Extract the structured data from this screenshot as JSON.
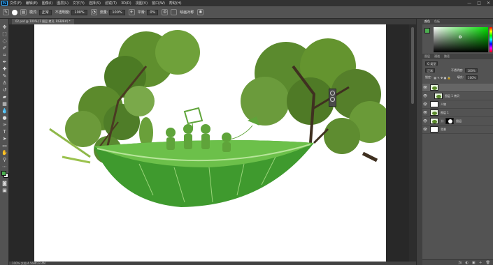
{
  "menubar": {
    "logo": "Ps",
    "items": [
      "文件(F)",
      "编辑(E)",
      "图像(I)",
      "图层(L)",
      "文字(Y)",
      "选择(S)",
      "滤镜(T)",
      "3D(D)",
      "视图(V)",
      "窗口(W)",
      "帮助(H)"
    ],
    "window_controls": [
      "—",
      "□",
      "✕"
    ]
  },
  "options": {
    "mode_label": "模式:",
    "mode_value": "正常",
    "opacity_label": "不透明度:",
    "opacity_value": "100%",
    "flow_label": "流量:",
    "flow_value": "100%",
    "smooth_label": "平滑:",
    "smooth_value": "0%",
    "symmetry_label": "绘画对称"
  },
  "document": {
    "tab_label": "02.psd @ 100% (1 图层 拷贝, RGB/8#) *",
    "status_text": "100%    文档:4.56M/33.4M"
  },
  "panels": {
    "color_tabs": [
      "颜色",
      "色板"
    ],
    "layer_tabs": [
      "图层",
      "通道",
      "路径"
    ],
    "kind_label": "Q 类型",
    "blend_mode": "正常",
    "opacity_label": "不透明度:",
    "opacity_value": "100%",
    "lock_label": "锁定:",
    "fill_label": "填充:",
    "fill_value": "100%",
    "layers": [
      {
        "name": "",
        "selected": true,
        "type": "tree"
      },
      {
        "name": "图层 1 拷贝",
        "selected": false,
        "type": "tree"
      },
      {
        "name": "人物",
        "selected": false,
        "type": "plain"
      },
      {
        "name": "图层 1",
        "selected": false,
        "type": "tree"
      },
      {
        "name": "图层",
        "selected": false,
        "type": "mask"
      },
      {
        "name": "背景",
        "selected": false,
        "type": "plain"
      }
    ],
    "bottom_icons": [
      "ƒx",
      "◐",
      "▣",
      "＋",
      "🗑"
    ]
  },
  "colors": {
    "foreground": "#4caf50",
    "background": "#ffffff",
    "canvas": "#ffffff"
  }
}
